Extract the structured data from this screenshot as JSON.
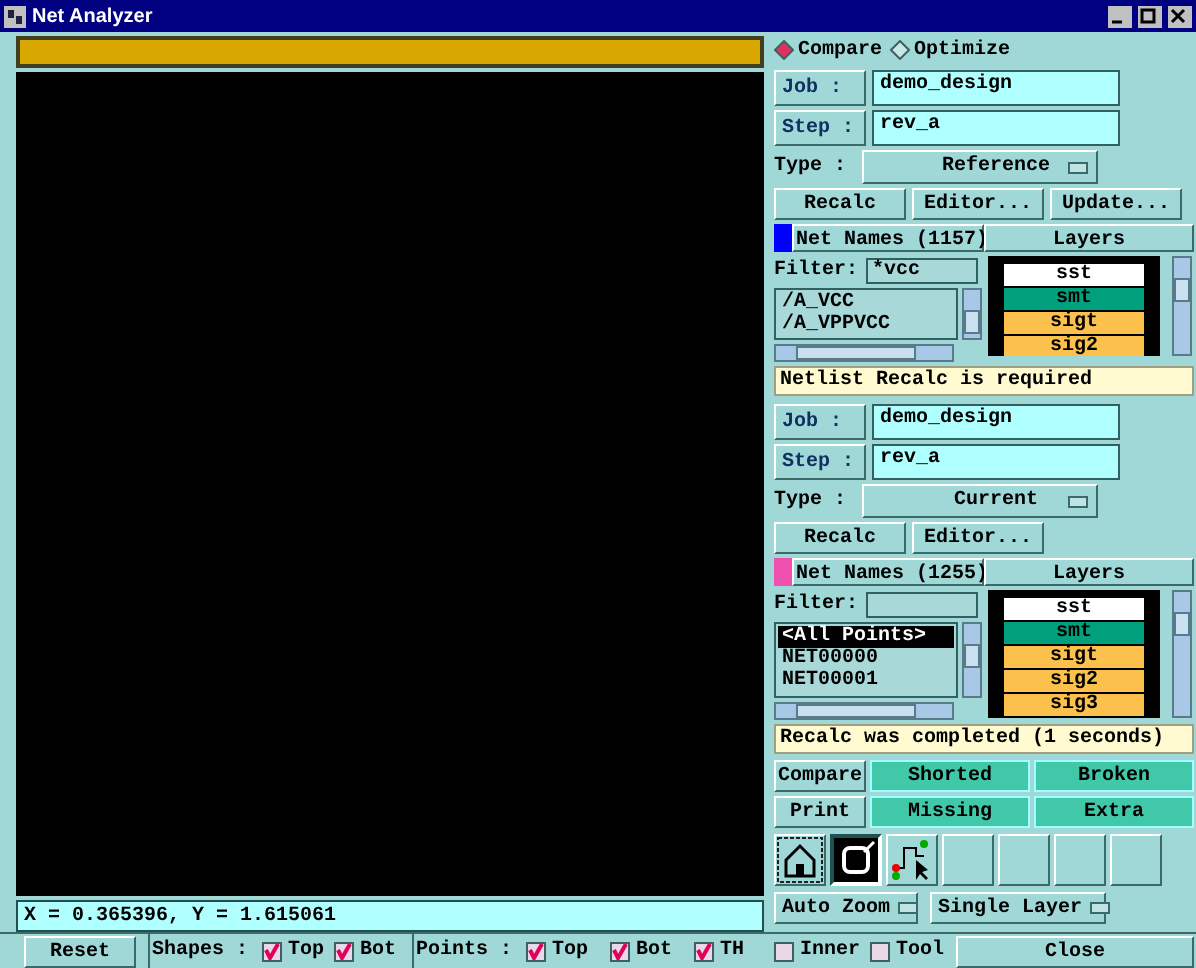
{
  "window": {
    "title": "Net Analyzer"
  },
  "coordinates": "X = 0.365396, Y = 1.615061",
  "mode_options": [
    {
      "label": "Compare",
      "selected": true
    },
    {
      "label": "Optimize",
      "selected": false
    }
  ],
  "sections": [
    {
      "job_label": "Job :",
      "job": "demo_design",
      "step_label": "Step :",
      "step": "rev_a",
      "type_label": "Type :",
      "type": "Reference",
      "buttons": [
        "Recalc",
        "Editor...",
        "Update..."
      ],
      "net_names": "Net Names (1157)",
      "color": "#0000ff",
      "layers_label": "Layers",
      "filter_label": "Filter:",
      "filter": "*vcc",
      "nets": [
        {
          "label": "/A_VCC",
          "selected": false
        },
        {
          "label": "/A_VPPVCC",
          "selected": false
        }
      ],
      "layers": [
        {
          "name": "sst",
          "color": "#ffffff"
        },
        {
          "name": "smt",
          "color": "#00a07c"
        },
        {
          "name": "sigt",
          "color": "#fcc04c"
        },
        {
          "name": "sig2",
          "color": "#fcc04c"
        }
      ],
      "message": "Netlist Recalc is required"
    },
    {
      "job_label": "Job :",
      "job": "demo_design",
      "step_label": "Step :",
      "step": "rev_a",
      "type_label": "Type :",
      "type": "Current",
      "buttons": [
        "Recalc",
        "Editor..."
      ],
      "net_names": "Net Names (1255)",
      "color": "#f050b0",
      "layers_label": "Layers",
      "filter_label": "Filter:",
      "nets": [
        {
          "label": "<All Points>",
          "selected": true
        },
        {
          "label": "NET00000",
          "selected": false
        },
        {
          "label": "NET00001",
          "selected": false
        }
      ],
      "layers": [
        {
          "name": "sst",
          "color": "#ffffff"
        },
        {
          "name": "smt",
          "color": "#00a07c"
        },
        {
          "name": "sigt",
          "color": "#fcc04c"
        },
        {
          "name": "sig2",
          "color": "#fcc04c"
        },
        {
          "name": "sig3",
          "color": "#fcc04c"
        }
      ],
      "message": "Recalc was completed (1 seconds)"
    }
  ],
  "actions": [
    {
      "label": "Compare",
      "kind": "plain"
    },
    {
      "label": "Shorted",
      "kind": "filter"
    },
    {
      "label": "Broken",
      "kind": "filter"
    },
    {
      "label": "Print",
      "kind": "plain"
    },
    {
      "label": "Missing",
      "kind": "filter"
    },
    {
      "label": "Extra",
      "kind": "filter"
    }
  ],
  "tools": [
    {
      "kind": "home",
      "selected": false
    },
    {
      "kind": "frame",
      "selected": true
    },
    {
      "kind": "route",
      "selected": false
    },
    {
      "kind": "empty",
      "selected": false
    },
    {
      "kind": "empty",
      "selected": false
    },
    {
      "kind": "empty",
      "selected": false
    },
    {
      "kind": "empty",
      "selected": false
    }
  ],
  "dropdowns": [
    "Auto Zoom",
    "Single Layer"
  ],
  "bottom_bar": {
    "reset": "Reset",
    "groups": [
      {
        "label": "Shapes :",
        "checks": [
          {
            "label": "Top",
            "checked": true
          },
          {
            "label": "Bot",
            "checked": true
          }
        ]
      },
      {
        "label": "Points :",
        "checks": [
          {
            "label": "Top",
            "checked": true
          },
          {
            "label": "Bot",
            "checked": true
          },
          {
            "label": "TH",
            "checked": true
          }
        ]
      }
    ],
    "options": [
      {
        "label": "Inner",
        "checked": false
      },
      {
        "label": "Tool",
        "checked": false
      }
    ],
    "close": "Close"
  }
}
